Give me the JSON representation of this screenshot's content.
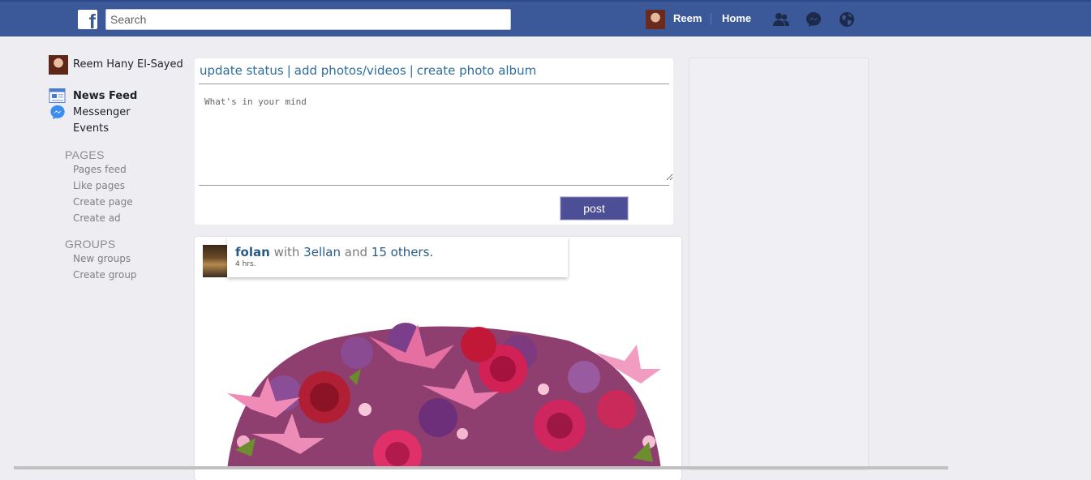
{
  "topbar": {
    "logo_icon": "facebook-logo-icon",
    "search_placeholder": "Search",
    "user_name": "Reem",
    "home_label": "Home",
    "icons": [
      "friends-icon",
      "messenger-icon",
      "globe-icon"
    ],
    "background": "#3b5998"
  },
  "sidebar": {
    "user_full_name": "Reem Hany El-Sayed",
    "nav": [
      {
        "label": "News Feed",
        "icon": "news-feed-icon"
      },
      {
        "label": "Messenger",
        "icon": "messenger-icon"
      },
      {
        "label": "Events",
        "icon": ""
      }
    ],
    "pages_title": "PAGES",
    "pages_links": [
      "Pages feed",
      "Like pages",
      "Create page",
      "Create ad"
    ],
    "groups_title": "GROUPS",
    "groups_links": [
      "New groups",
      "Create group"
    ]
  },
  "composer": {
    "tabs": [
      "update status",
      "add photos/videos",
      "create photo album"
    ],
    "separator": "|",
    "placeholder": "What's in your mind",
    "post_label": "post"
  },
  "post": {
    "author": "folan",
    "with_text": "with",
    "tagged": "3ellan",
    "and_text": "and",
    "others": "15 others.",
    "time": "4 hrs.",
    "image": "flower-bouquet"
  }
}
